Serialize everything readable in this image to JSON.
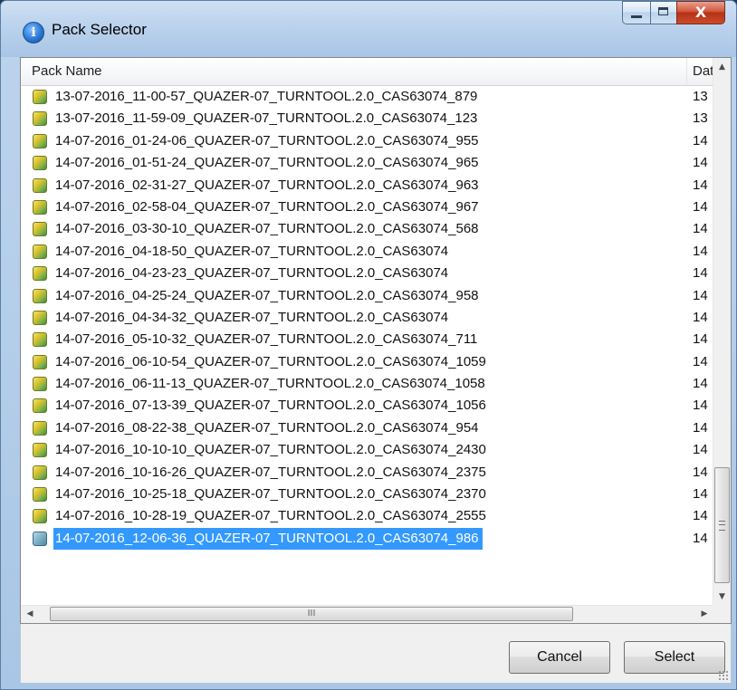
{
  "window": {
    "title": "Pack Selector",
    "icon": "app-info-icon",
    "controls": {
      "minimize": "minimize-icon",
      "maximize": "maximize-icon",
      "close_glyph": "X"
    }
  },
  "list": {
    "columns": [
      {
        "label": "Pack Name"
      },
      {
        "label": "Date"
      }
    ],
    "rows": [
      {
        "name": "13-07-2016_11-00-57_QUAZER-07_TURNTOOL.2.0_CAS63074_879",
        "date": "13"
      },
      {
        "name": "13-07-2016_11-59-09_QUAZER-07_TURNTOOL.2.0_CAS63074_123",
        "date": "13"
      },
      {
        "name": "14-07-2016_01-24-06_QUAZER-07_TURNTOOL.2.0_CAS63074_955",
        "date": "14"
      },
      {
        "name": "14-07-2016_01-51-24_QUAZER-07_TURNTOOL.2.0_CAS63074_965",
        "date": "14"
      },
      {
        "name": "14-07-2016_02-31-27_QUAZER-07_TURNTOOL.2.0_CAS63074_963",
        "date": "14"
      },
      {
        "name": "14-07-2016_02-58-04_QUAZER-07_TURNTOOL.2.0_CAS63074_967",
        "date": "14"
      },
      {
        "name": "14-07-2016_03-30-10_QUAZER-07_TURNTOOL.2.0_CAS63074_568",
        "date": "14"
      },
      {
        "name": "14-07-2016_04-18-50_QUAZER-07_TURNTOOL.2.0_CAS63074",
        "date": "14"
      },
      {
        "name": "14-07-2016_04-23-23_QUAZER-07_TURNTOOL.2.0_CAS63074",
        "date": "14"
      },
      {
        "name": "14-07-2016_04-25-24_QUAZER-07_TURNTOOL.2.0_CAS63074_958",
        "date": "14"
      },
      {
        "name": "14-07-2016_04-34-32_QUAZER-07_TURNTOOL.2.0_CAS63074",
        "date": "14"
      },
      {
        "name": "14-07-2016_05-10-32_QUAZER-07_TURNTOOL.2.0_CAS63074_711",
        "date": "14"
      },
      {
        "name": "14-07-2016_06-10-54_QUAZER-07_TURNTOOL.2.0_CAS63074_1059",
        "date": "14"
      },
      {
        "name": "14-07-2016_06-11-13_QUAZER-07_TURNTOOL.2.0_CAS63074_1058",
        "date": "14"
      },
      {
        "name": "14-07-2016_07-13-39_QUAZER-07_TURNTOOL.2.0_CAS63074_1056",
        "date": "14"
      },
      {
        "name": "14-07-2016_08-22-38_QUAZER-07_TURNTOOL.2.0_CAS63074_954",
        "date": "14"
      },
      {
        "name": "14-07-2016_10-10-10_QUAZER-07_TURNTOOL.2.0_CAS63074_2430",
        "date": "14"
      },
      {
        "name": "14-07-2016_10-16-26_QUAZER-07_TURNTOOL.2.0_CAS63074_2375",
        "date": "14"
      },
      {
        "name": "14-07-2016_10-25-18_QUAZER-07_TURNTOOL.2.0_CAS63074_2370",
        "date": "14"
      },
      {
        "name": "14-07-2016_10-28-19_QUAZER-07_TURNTOOL.2.0_CAS63074_2555",
        "date": "14"
      },
      {
        "name": "14-07-2016_12-06-36_QUAZER-07_TURNTOOL.2.0_CAS63074_986",
        "date": "14",
        "selected": true
      }
    ],
    "row_icon": "pack-icon",
    "selection_color": "#3399ff",
    "hscroll_thumb_glyph": "III"
  },
  "buttons": {
    "cancel_label": "Cancel",
    "select_label": "Select"
  }
}
